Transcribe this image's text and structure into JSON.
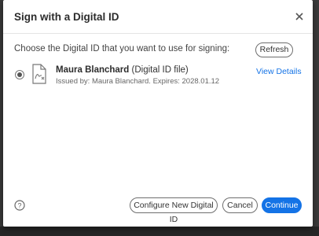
{
  "dialog": {
    "title": "Sign with a Digital ID",
    "prompt": "Choose the Digital ID that you want to use for signing:",
    "refresh_label": "Refresh",
    "digital_id": {
      "name": "Maura Blanchard",
      "type": "(Digital ID file)",
      "issued": "Issued by: Maura Blanchard. Expires: 2028.01.12",
      "view_details_label": "View Details",
      "selected": true
    },
    "footer": {
      "configure_label": "Configure New Digital ID",
      "cancel_label": "Cancel",
      "continue_label": "Continue"
    }
  },
  "colors": {
    "accent": "#1473e6",
    "backdrop": "#2b2b2b"
  },
  "icons": {
    "close": "close-icon",
    "help": "help-icon",
    "file": "digital-id-file-icon"
  }
}
